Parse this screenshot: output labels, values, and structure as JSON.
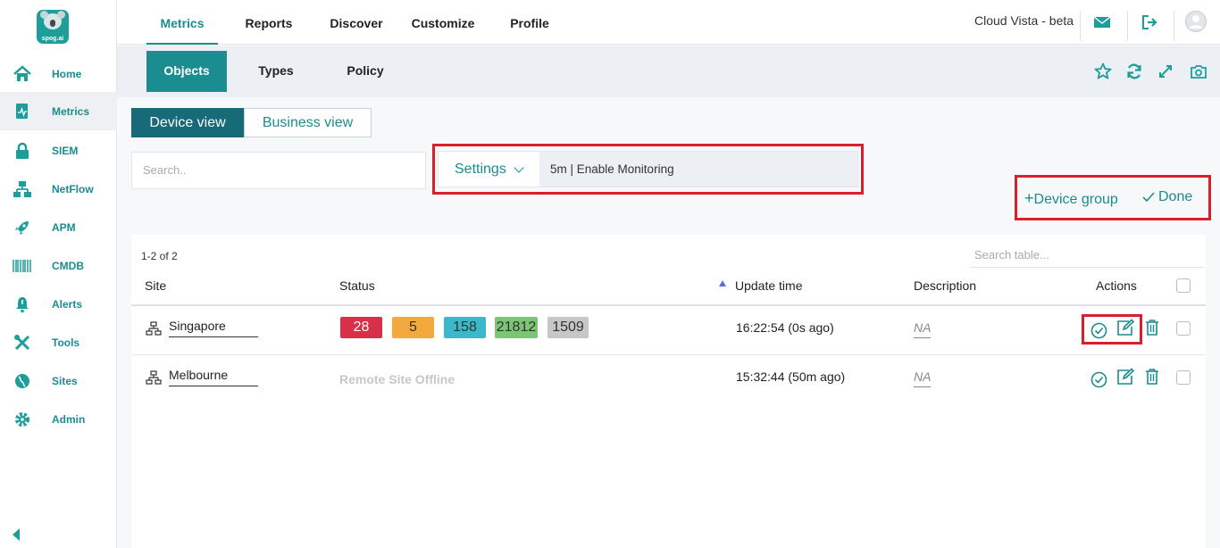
{
  "brand": {
    "logo_text": "spog.ai"
  },
  "sidebar": {
    "items": [
      {
        "label": "Home",
        "icon": "home-icon"
      },
      {
        "label": "Metrics",
        "icon": "metrics-icon",
        "active": true
      },
      {
        "label": "SIEM",
        "icon": "lock-icon"
      },
      {
        "label": "NetFlow",
        "icon": "netflow-icon"
      },
      {
        "label": "APM",
        "icon": "rocket-icon"
      },
      {
        "label": "CMDB",
        "icon": "barcode-icon"
      },
      {
        "label": "Alerts",
        "icon": "alert-bell-icon"
      },
      {
        "label": "Tools",
        "icon": "tools-icon"
      },
      {
        "label": "Sites",
        "icon": "globe-icon"
      },
      {
        "label": "Admin",
        "icon": "gear-icon"
      }
    ]
  },
  "topnav": {
    "items": [
      "Metrics",
      "Reports",
      "Discover",
      "Customize",
      "Profile"
    ],
    "active": "Metrics",
    "app_name": "Cloud Vista - beta"
  },
  "subnav": {
    "items": [
      "Objects",
      "Types",
      "Policy"
    ],
    "active": "Objects"
  },
  "view_toggle": {
    "device": "Device view",
    "business": "Business view",
    "active": "Device view"
  },
  "search": {
    "placeholder": "Search.."
  },
  "settings": {
    "label": "Settings",
    "value": "5m | Enable Monitoring"
  },
  "actions_bar": {
    "device_group": "Device group",
    "done": "Done"
  },
  "table": {
    "count": "1-2 of 2",
    "search_placeholder": "Search table...",
    "columns": [
      "Site",
      "Status",
      "Update time",
      "Description",
      "Actions"
    ],
    "rows": [
      {
        "site": "Singapore",
        "status_badges": [
          {
            "value": "28",
            "color": "#d9304a"
          },
          {
            "value": "5",
            "color": "#f3a93b"
          },
          {
            "value": "158",
            "color": "#39b9c9"
          },
          {
            "value": "21812",
            "color": "#7cc576"
          },
          {
            "value": "1509",
            "color": "#c7c7c7"
          }
        ],
        "update_time": "16:22:54 (0s ago)",
        "description": "NA"
      },
      {
        "site": "Melbourne",
        "status_text": "Remote Site Offline",
        "update_time": "15:32:44 (50m ago)",
        "description": "NA"
      }
    ]
  },
  "colors": {
    "accent": "#1b8c8f",
    "highlight": "#d9202a"
  }
}
